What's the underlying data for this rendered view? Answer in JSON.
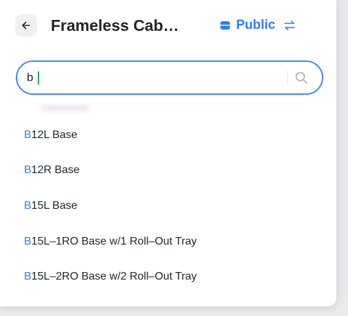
{
  "header": {
    "back_label": "Back",
    "title": "Frameless Cab…",
    "scope_label": "Public"
  },
  "search": {
    "value": "b",
    "placeholder": ""
  },
  "results": [
    {
      "match": "B",
      "rest": "12L Base"
    },
    {
      "match": "B",
      "rest": "12R Base"
    },
    {
      "match": "B",
      "rest": "15L Base"
    },
    {
      "match": "B",
      "rest": "15L–1RO Base w/1 Roll–Out Tray"
    },
    {
      "match": "B",
      "rest": "15L–2RO Base w/2 Roll–Out Tray"
    }
  ],
  "colors": {
    "accent": "#2f7cf6",
    "text": "#1f2329",
    "caret": "#1db14b"
  },
  "icons": {
    "back": "arrow-left-icon",
    "scope": "database-icon",
    "swap": "swap-icon",
    "search": "search-icon"
  }
}
